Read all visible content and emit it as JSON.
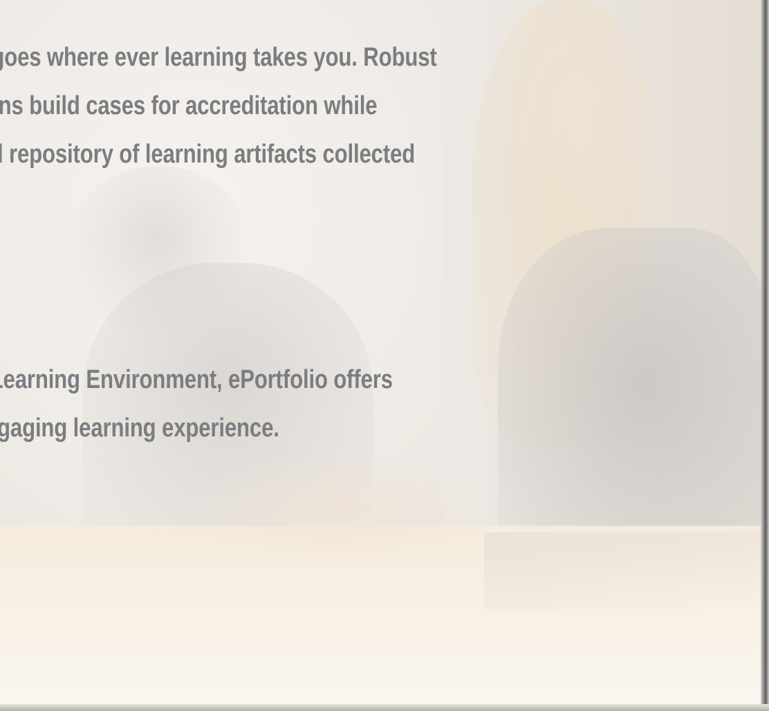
{
  "paragraph1": {
    "line1": "o goes where ever learning takes you. Robust",
    "line2": "tions build cases for accreditation while",
    "line3": "nal repository of learning artifacts collected"
  },
  "paragraph2": {
    "line1": "e Learning Environment, ePortfolio offers",
    "line2": "engaging learning experience."
  },
  "colors": {
    "text": "#7b7d81",
    "background": "#f1eee9"
  },
  "icons": {
    "background": "faded-photo-two-women-at-table"
  }
}
